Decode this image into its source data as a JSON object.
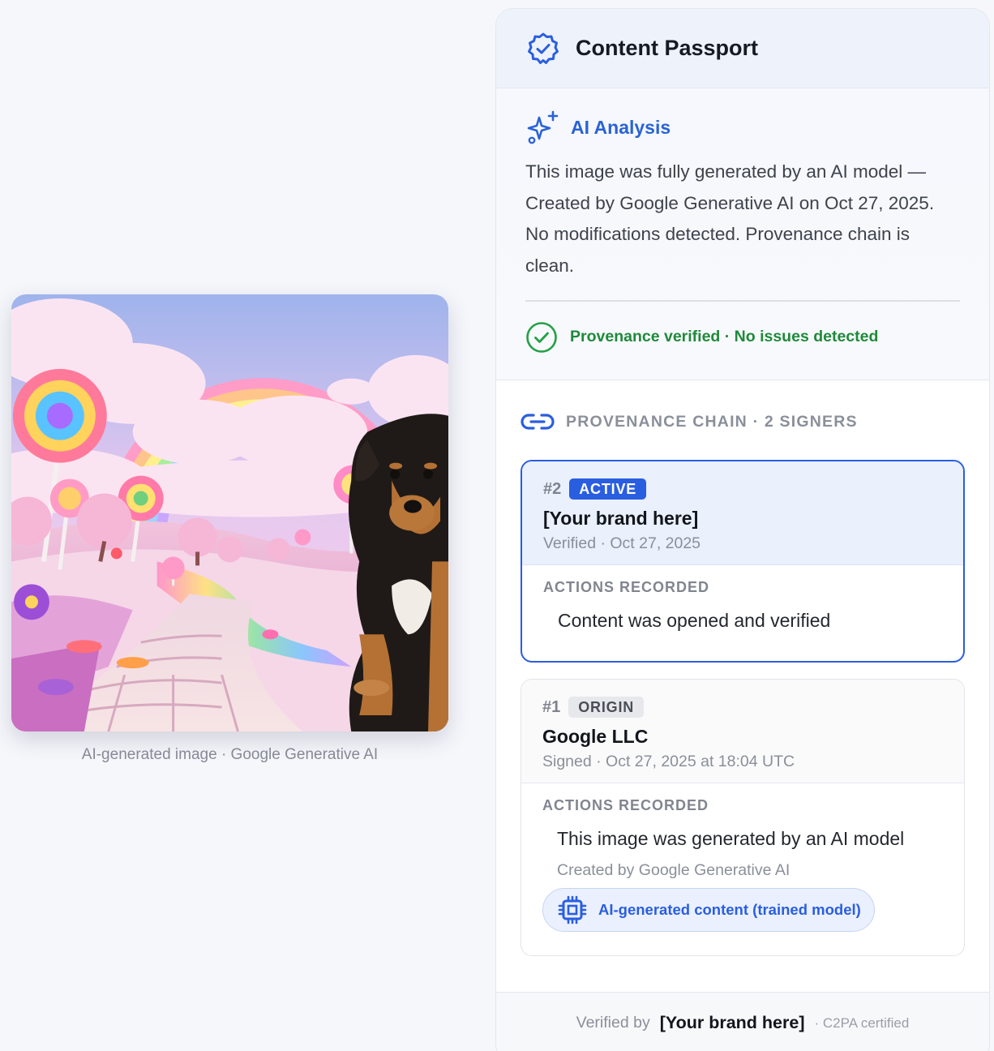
{
  "image": {
    "alt": "candy landscape with rainbow, lollipops and a puppy",
    "caption": "AI-generated image · Google Generative AI"
  },
  "panel": {
    "title": "Content Passport",
    "header_icon": "verified-badge-icon"
  },
  "ai_analysis": {
    "title": "AI Analysis",
    "icon": "sparkles-icon",
    "text": "This image was fully generated by an AI model — Created by Google Generative AI on Oct 27, 2025. No modifications detected. Provenance chain is clean.",
    "status_icon": "check-circle-icon",
    "status": "Provenance verified · No issues detected"
  },
  "chain": {
    "icon": "link-icon",
    "title": "PROVENANCE CHAIN · 2 SIGNERS",
    "signers": [
      {
        "number": "#2",
        "badge": "ACTIVE",
        "name": "[Your brand here]",
        "meta": "Verified · Oct 27, 2025",
        "actions_label": "ACTIONS RECORDED",
        "action": "Content was opened and verified"
      },
      {
        "number": "#1",
        "badge": "ORIGIN",
        "name": "Google LLC",
        "meta": "Signed · Oct 27, 2025 at 18:04 UTC",
        "actions_label": "ACTIONS RECORDED",
        "action": "This image was generated by an AI model",
        "action_sub": "Created by Google Generative AI",
        "chip_icon": "chip-icon",
        "chip": "AI-generated content (trained model)"
      }
    ]
  },
  "footer": {
    "prefix": "Verified by",
    "brand": "[Your brand here]",
    "suffix": "· C2PA certified"
  },
  "colors": {
    "accent": "#2a5ee0",
    "success": "#1f8a3b",
    "header_bg": "#eef2fb"
  }
}
